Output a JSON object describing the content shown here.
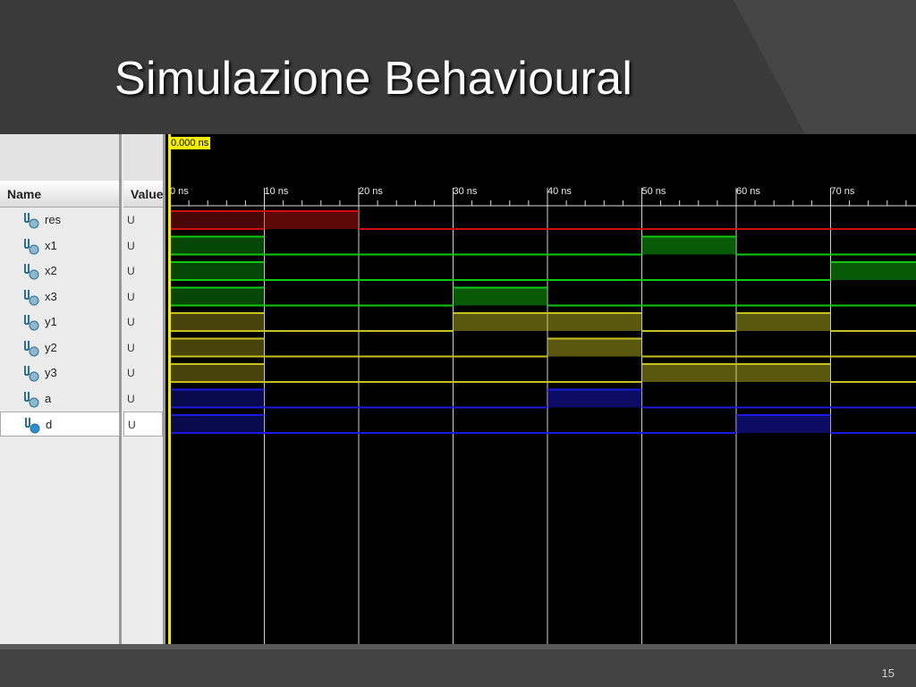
{
  "slide": {
    "title": "Simulazione Behavioural",
    "page_number": "15"
  },
  "simulator": {
    "cursor_time": "0.000 ns",
    "name_header": "Name",
    "value_header": "Value",
    "ruler_labels": [
      "0 ns",
      "10 ns",
      "20 ns",
      "30 ns",
      "40 ns",
      "50 ns",
      "60 ns",
      "70 ns"
    ],
    "signals": [
      {
        "name": "res",
        "value": "U",
        "color": "#d01010",
        "high_intervals_ns": [
          [
            10,
            20
          ]
        ],
        "selected": false
      },
      {
        "name": "x1",
        "value": "U",
        "color": "#11c811",
        "high_intervals_ns": [
          [
            50,
            60
          ]
        ],
        "selected": false
      },
      {
        "name": "x2",
        "value": "U",
        "color": "#11c811",
        "high_intervals_ns": [
          [
            70,
            80
          ]
        ],
        "selected": false
      },
      {
        "name": "x3",
        "value": "U",
        "color": "#11c811",
        "high_intervals_ns": [
          [
            30,
            40
          ]
        ],
        "selected": false
      },
      {
        "name": "y1",
        "value": "U",
        "color": "#c8c020",
        "high_intervals_ns": [
          [
            30,
            40
          ],
          [
            40,
            50
          ],
          [
            60,
            70
          ]
        ],
        "selected": false
      },
      {
        "name": "y2",
        "value": "U",
        "color": "#c8c020",
        "high_intervals_ns": [
          [
            40,
            50
          ]
        ],
        "selected": false
      },
      {
        "name": "y3",
        "value": "U",
        "color": "#c8c020",
        "high_intervals_ns": [
          [
            50,
            60
          ],
          [
            60,
            70
          ]
        ],
        "selected": false
      },
      {
        "name": "a",
        "value": "U",
        "color": "#1a1ae0",
        "high_intervals_ns": [
          [
            40,
            50
          ]
        ],
        "selected": false
      },
      {
        "name": "d",
        "value": "U",
        "color": "#1a1ae0",
        "high_intervals_ns": [
          [
            60,
            70
          ]
        ],
        "selected": true
      }
    ],
    "undefined_interval_ns": [
      0,
      10
    ],
    "time_range_ns": [
      0,
      80
    ]
  }
}
